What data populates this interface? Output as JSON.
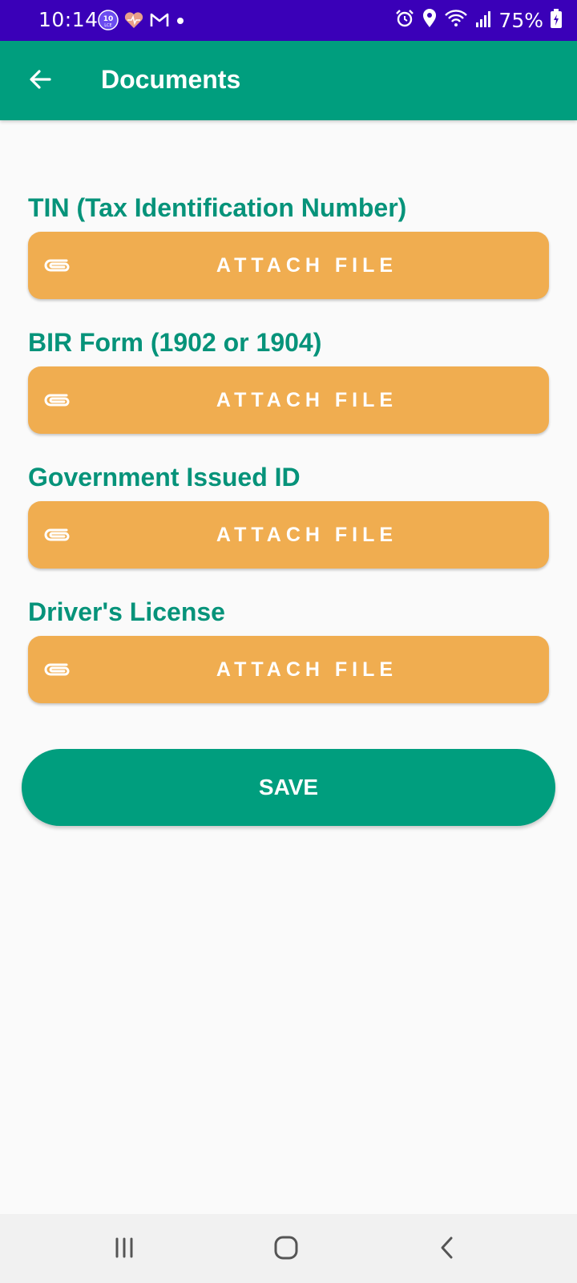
{
  "status_bar": {
    "time": "10:14",
    "battery": "75%",
    "left_icons": [
      "app-badge-icon",
      "heart-icon",
      "gmail-icon",
      "dot-icon"
    ],
    "right_icons": [
      "alarm-icon",
      "location-icon",
      "wifi-icon",
      "signal-icon",
      "battery-icon"
    ]
  },
  "header": {
    "title": "Documents",
    "back_icon": "arrow-left-icon",
    "background": "#009e7e"
  },
  "documents": [
    {
      "label": "TIN (Tax Identification Number)",
      "button": "ATTACH FILE"
    },
    {
      "label": "BIR Form (1902 or 1904)",
      "button": "ATTACH FILE"
    },
    {
      "label": "Government Issued ID",
      "button": "ATTACH FILE"
    },
    {
      "label": "Driver's License",
      "button": "ATTACH FILE"
    }
  ],
  "save_button": {
    "label": "SAVE"
  },
  "colors": {
    "status_bar": "#3a00b8",
    "accent": "#009e7e",
    "label_text": "#06937a",
    "attach_button": "#f0ad50"
  },
  "nav_bar": {
    "icons": [
      "recent-apps-icon",
      "home-icon",
      "back-icon"
    ]
  }
}
